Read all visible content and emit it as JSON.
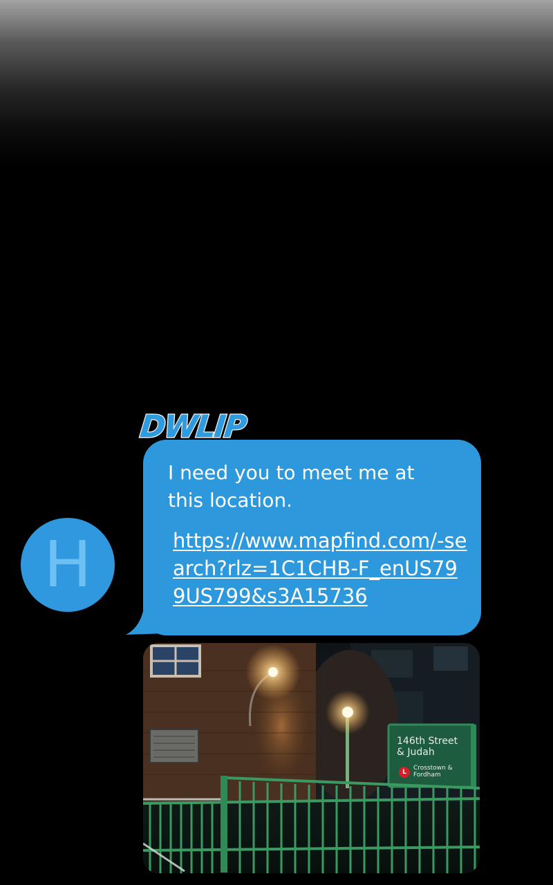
{
  "sound_effect": "DWLIP",
  "contact": {
    "avatar_letter": "H"
  },
  "message": {
    "text": "I need you to meet me at this location.",
    "link": "https://www.mapfind.com/-search?rlz=1C1CHB-F_enUS799US799&s3A15736",
    "bubble_color": "#2d98dc"
  },
  "attachment": {
    "sign_street": "146th Street & Judah",
    "sign_line_badge": "L",
    "sign_line_text": "Crosstown & Fordham"
  },
  "colors": {
    "accent": "#2d98dc",
    "avatar": "#2f98de",
    "avatar_letter": "#6dc0f2",
    "background": "#000000"
  }
}
